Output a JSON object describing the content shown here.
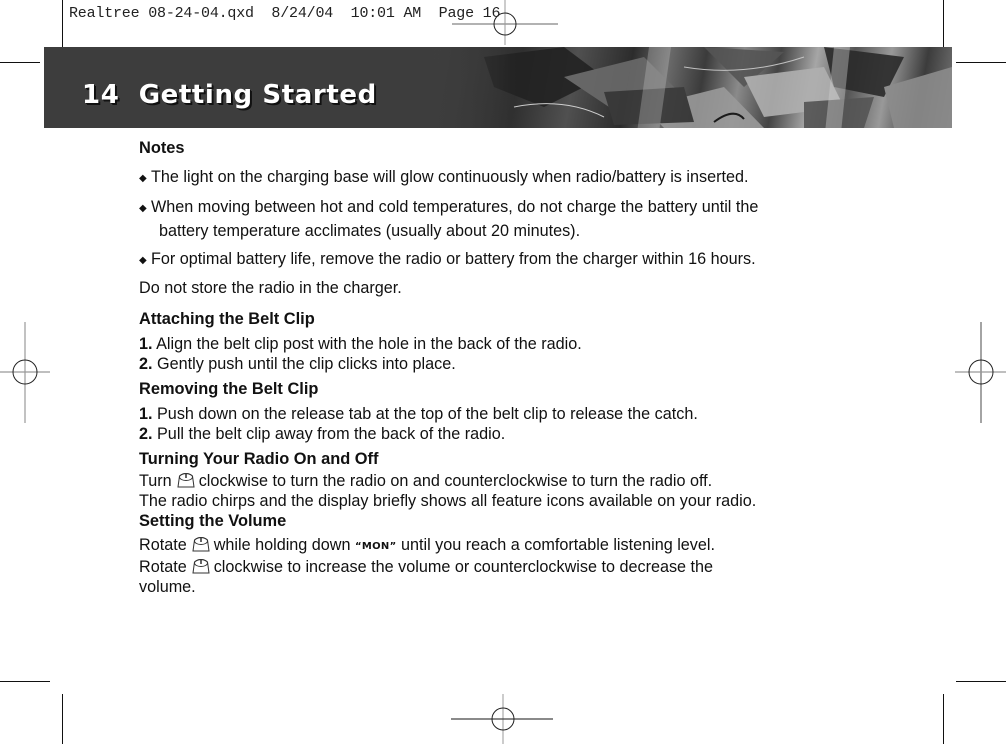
{
  "slug_line": "Realtree 08-24-04.qxd  8/24/04  10:01 AM  Page 16",
  "header": {
    "page_number": "14",
    "title": "Getting Started"
  },
  "notes": {
    "heading": "Notes",
    "bullets": [
      "The light on the charging base will glow continuously when radio/battery is inserted.",
      "When moving between hot and cold temperatures, do not charge the battery until the",
      "battery temperature acclimates (usually about 20 minutes).",
      "For optimal battery life, remove the radio or battery from the charger within 16 hours."
    ],
    "footer": "Do not store the radio in the charger."
  },
  "attaching": {
    "heading": "Attaching the Belt Clip",
    "steps": [
      {
        "num": "1.",
        "text": " Align the belt clip post with the hole in the back of the radio."
      },
      {
        "num": "2.",
        "text": " Gently push until the clip clicks into place."
      }
    ]
  },
  "removing": {
    "heading": "Removing the Belt Clip",
    "steps": [
      {
        "num": "1.",
        "text": " Push down on the release tab at the top of the belt clip to release the catch."
      },
      {
        "num": "2.",
        "text": " Pull the belt clip away from the back of the radio."
      }
    ]
  },
  "turning": {
    "heading": "Turning Your Radio On and Off",
    "line1_pre": "Turn",
    "line1_post": "clockwise to turn the radio on and counterclockwise to turn the radio off.",
    "line2": "The radio chirps and the display briefly shows all feature icons available on your radio."
  },
  "volume": {
    "heading": "Setting the Volume",
    "line1_pre": "Rotate",
    "line1_mid": "while holding down",
    "mon_label": "“MON”",
    "line1_post": "until you reach a comfortable listening level.",
    "line2_pre": "Rotate",
    "line2_post": "clockwise to increase the volume or counterclockwise to decrease the",
    "line3": "volume."
  },
  "icons": {
    "bullet": "diamond-bullet",
    "knob": "volume-power-knob"
  }
}
